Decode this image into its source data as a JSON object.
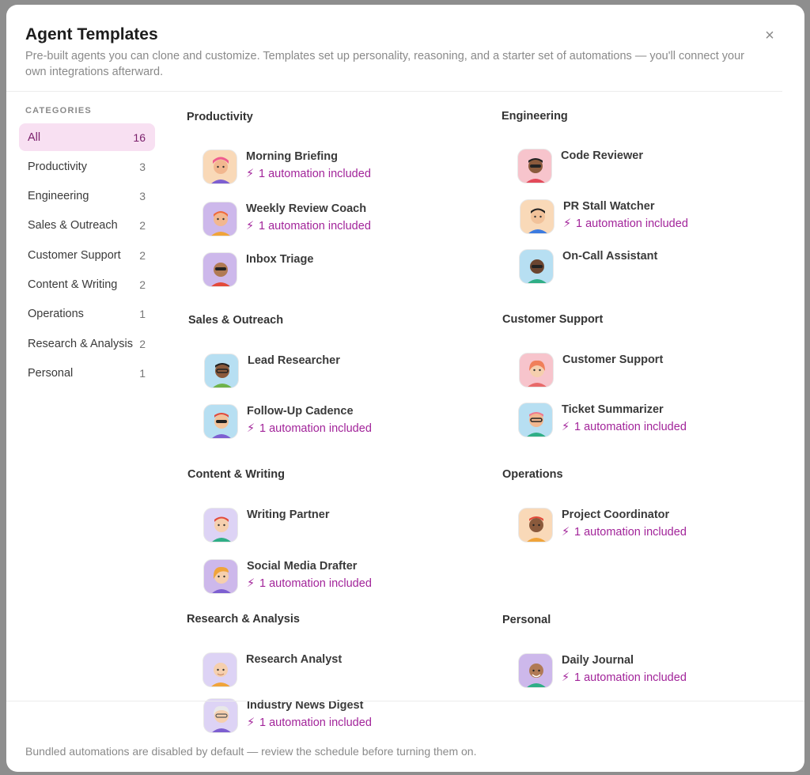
{
  "header": {
    "title": "Agent Templates",
    "subtitle": "Pre-built agents you can clone and customize. Templates set up personality, reasoning, and a starter set of automations — you'll connect your own integrations afterward."
  },
  "sidebar": {
    "heading": "CATEGORIES",
    "items": [
      {
        "label": "All",
        "count": "16"
      },
      {
        "label": "Productivity",
        "count": "3"
      },
      {
        "label": "Engineering",
        "count": "3"
      },
      {
        "label": "Sales & Outreach",
        "count": "2"
      },
      {
        "label": "Customer Support",
        "count": "2"
      },
      {
        "label": "Content & Writing",
        "count": "2"
      },
      {
        "label": "Operations",
        "count": "1"
      },
      {
        "label": "Research & Analysis",
        "count": "2"
      },
      {
        "label": "Personal",
        "count": "1"
      }
    ]
  },
  "automation_label": "1 automation included",
  "sections": {
    "productivity": {
      "title": "Productivity",
      "cards": [
        {
          "name": "Morning Briefing",
          "automation": "1 automation included"
        },
        {
          "name": "Weekly Review Coach",
          "automation": "1 automation included"
        },
        {
          "name": "Inbox Triage",
          "automation": ""
        }
      ]
    },
    "engineering": {
      "title": "Engineering",
      "cards": [
        {
          "name": "Code Reviewer",
          "automation": ""
        },
        {
          "name": "PR Stall Watcher",
          "automation": "1 automation included"
        },
        {
          "name": "On-Call Assistant",
          "automation": ""
        }
      ]
    },
    "sales": {
      "title": "Sales & Outreach",
      "cards": [
        {
          "name": "Lead Researcher",
          "automation": ""
        },
        {
          "name": "Follow-Up Cadence",
          "automation": "1 automation included"
        }
      ]
    },
    "support": {
      "title": "Customer Support",
      "cards": [
        {
          "name": "Customer Support",
          "automation": ""
        },
        {
          "name": "Ticket Summarizer",
          "automation": "1 automation included"
        }
      ]
    },
    "content": {
      "title": "Content & Writing",
      "cards": [
        {
          "name": "Writing Partner",
          "automation": ""
        },
        {
          "name": "Social Media Drafter",
          "automation": "1 automation included"
        }
      ]
    },
    "operations": {
      "title": "Operations",
      "cards": [
        {
          "name": "Project Coordinator",
          "automation": "1 automation included"
        }
      ]
    },
    "research": {
      "title": "Research & Analysis",
      "cards": [
        {
          "name": "Research Analyst",
          "automation": ""
        },
        {
          "name": "Industry News Digest",
          "automation": "1 automation included"
        }
      ]
    },
    "personal": {
      "title": "Personal",
      "cards": [
        {
          "name": "Daily Journal",
          "automation": "1 automation included"
        }
      ]
    }
  },
  "footer": {
    "note": "Bundled automations are disabled by default — review the schedule before turning them on."
  },
  "colors": {
    "accent": "#a2249a",
    "active_bg": "#f8e0f2"
  }
}
